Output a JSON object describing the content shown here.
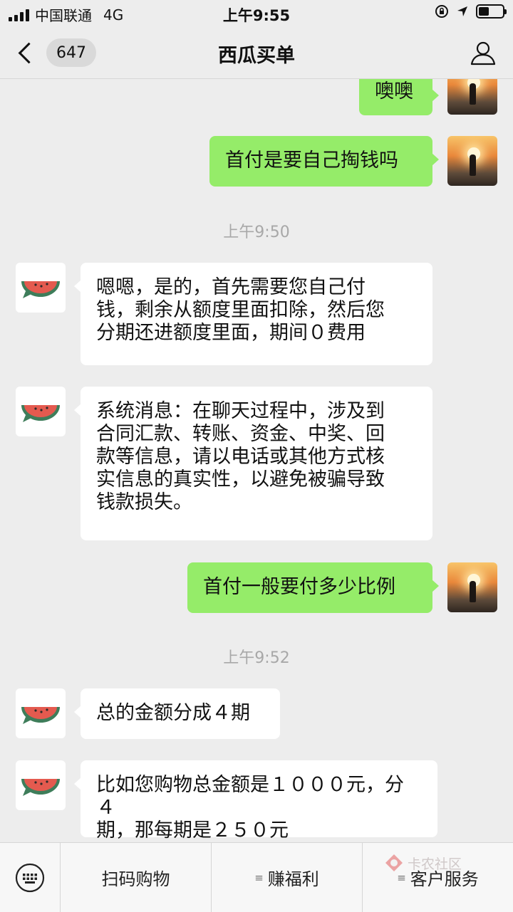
{
  "status_bar": {
    "carrier": "中国联通",
    "network": "4G",
    "time": "上午9:55",
    "battery_level": 0.45
  },
  "nav": {
    "unread_count": "647",
    "title": "西瓜买单"
  },
  "messages": [
    {
      "side": "me",
      "text": "噢噢"
    },
    {
      "side": "me",
      "text": "首付是要自己掏钱吗"
    },
    {
      "timestamp": "上午9:50"
    },
    {
      "side": "bot",
      "text": "嗯嗯，是的，首先需要您自己付\n钱，剩余从额度里面扣除，然后您\n分期还进额度里面，期间０费用"
    },
    {
      "side": "bot",
      "text": "系统消息：在聊天过程中，涉及到\n合同汇款、转账、资金、中奖、回\n款等信息，请以电话或其他方式核\n实信息的真实性，以避免被骗导致\n钱款损失。"
    },
    {
      "side": "me",
      "text": "首付一般要付多少比例"
    },
    {
      "timestamp": "上午9:52"
    },
    {
      "side": "bot",
      "text": "总的金额分成４期"
    },
    {
      "side": "bot",
      "text": "比如您购物总金额是１０００元，分４\n期，那每期是２５０元"
    }
  ],
  "bottom_menu": {
    "items": [
      "扫码购物",
      "赚福利",
      "客户服务"
    ]
  },
  "watermark": {
    "text": "卡农社区"
  },
  "colors": {
    "my_bubble": "#95ec69",
    "bot_bubble": "#ffffff",
    "background": "#ededed"
  }
}
